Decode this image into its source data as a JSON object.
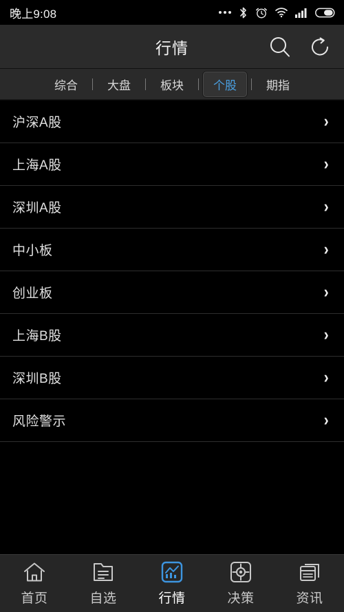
{
  "colors": {
    "background": "#000000",
    "header_bg": "#2b2b2b",
    "tabbar_bg": "#2a2a2a",
    "bottomnav_bg": "#262626",
    "accent": "#4a9fe0",
    "text": "#e0e0e0",
    "divider": "#2e2e2e"
  },
  "statusbar": {
    "time": "晚上9:08",
    "icons": [
      {
        "name": "more-dots-icon"
      },
      {
        "name": "bluetooth-icon"
      },
      {
        "name": "alarm-clock-icon"
      },
      {
        "name": "wifi-icon"
      },
      {
        "name": "cellular-signal-icon"
      },
      {
        "name": "battery-icon"
      }
    ]
  },
  "header": {
    "title": "行情",
    "search_icon": "search-icon",
    "refresh_icon": "refresh-icon"
  },
  "tabs": [
    {
      "label": "综合",
      "active": false
    },
    {
      "label": "大盘",
      "active": false
    },
    {
      "label": "板块",
      "active": false
    },
    {
      "label": "个股",
      "active": true
    },
    {
      "label": "期指",
      "active": false
    }
  ],
  "list": {
    "chevron": "›",
    "items": [
      {
        "label": "沪深A股"
      },
      {
        "label": "上海A股"
      },
      {
        "label": "深圳A股"
      },
      {
        "label": "中小板"
      },
      {
        "label": "创业板"
      },
      {
        "label": "上海B股"
      },
      {
        "label": "深圳B股"
      },
      {
        "label": "风险警示"
      }
    ]
  },
  "bottomnav": {
    "items": [
      {
        "label": "首页",
        "icon": "home-icon",
        "active": false
      },
      {
        "label": "自选",
        "icon": "folder-list-icon",
        "active": false
      },
      {
        "label": "行情",
        "icon": "chart-icon",
        "active": true
      },
      {
        "label": "决策",
        "icon": "target-crosshair-icon",
        "active": false
      },
      {
        "label": "资讯",
        "icon": "news-windows-icon",
        "active": false
      }
    ]
  }
}
